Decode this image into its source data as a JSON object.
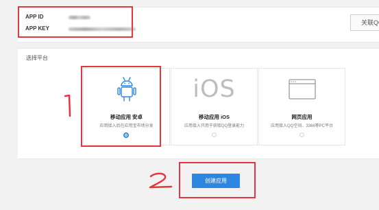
{
  "credentials": {
    "app_id_label": "APP ID",
    "app_key_label": "APP KEY"
  },
  "link_qq_button": "关联QQ",
  "platform_section": {
    "label": "选择平台",
    "options": [
      {
        "title": "移动应用 安卓",
        "desc": "应用接入后在应用宝市场分发",
        "selected": true,
        "icon": "android-icon"
      },
      {
        "title": "移动应用 iOS",
        "desc": "应用接入只用于获取QQ登录能力",
        "selected": false,
        "icon": "ios-icon",
        "icon_text": "iOS"
      },
      {
        "title": "网页应用",
        "desc": "应用接入QQ空间、3366等PC平台",
        "selected": false,
        "icon": "browser-window-icon"
      }
    ]
  },
  "create_button": "创建应用",
  "annotations": {
    "first": "1",
    "second": "2"
  },
  "colors": {
    "accent": "#2d86e0",
    "annotation_red": "#e0383e"
  }
}
